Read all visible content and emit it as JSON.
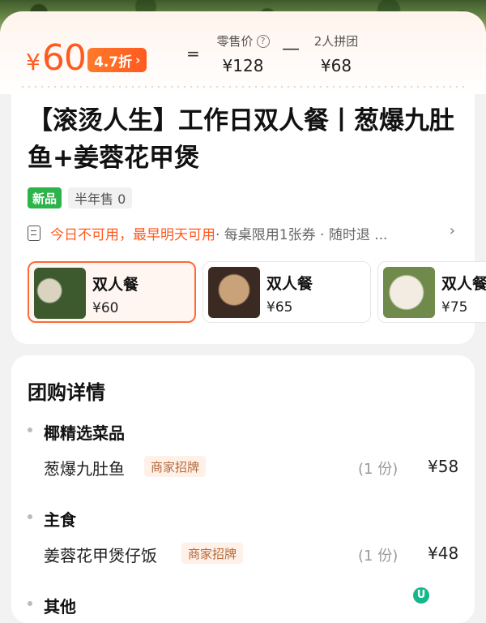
{
  "header": {
    "price_symbol": "¥",
    "price_value": "60",
    "discount_label": "4.7折",
    "equals": "=",
    "retail_label": "零售价",
    "retail_price": "¥128",
    "minus": "—",
    "group_label": "2人拼团",
    "group_price": "¥68"
  },
  "product": {
    "title": "【滚烫人生】工作日双人餐丨葱爆九肚鱼+姜蓉花甲煲",
    "tag_new": "新品",
    "half_year_sales": "半年售 0",
    "notice_orange": "今日不可用，最早明天可用",
    "notice_gray": " · 每桌限用1张券 · 随时退 ..."
  },
  "packages": [
    {
      "name": "双人餐",
      "price": "¥60",
      "selected": true
    },
    {
      "name": "双人餐",
      "price": "¥65",
      "selected": false
    },
    {
      "name": "双人餐",
      "price": "¥75",
      "selected": false
    }
  ],
  "details": {
    "title": "团购详情",
    "sections": [
      {
        "head": "椰精选菜品",
        "item": "葱爆九肚鱼",
        "badge": "商家招牌",
        "qty": "(1 份)",
        "price": "¥58"
      },
      {
        "head": "主食",
        "item": "姜蓉花甲煲仔饭",
        "badge": "商家招牌",
        "qty": "(1 份)",
        "price": "¥48"
      },
      {
        "head": "其他"
      }
    ]
  },
  "colors": {
    "accent": "#ff5a1f",
    "new_tag": "#2cb34a"
  },
  "icons": {
    "info": "question-circle-icon",
    "notice": "document-icon",
    "more": "chevron-right-icon",
    "floating": "assistant-icon"
  }
}
